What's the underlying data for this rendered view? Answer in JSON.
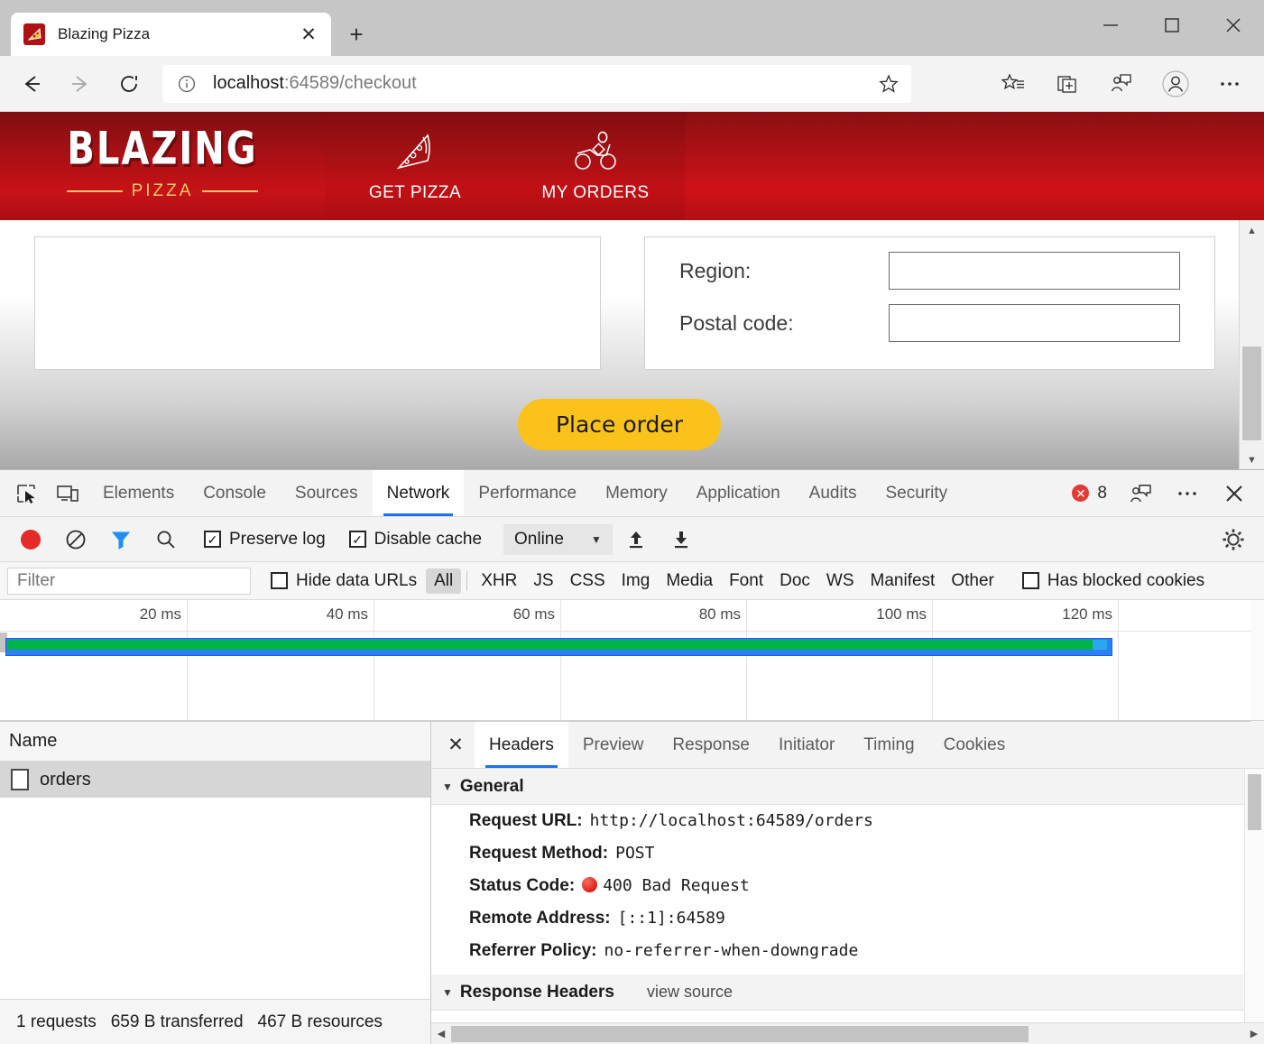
{
  "browser": {
    "tab": {
      "title": "Blazing Pizza",
      "favicon": "pizza-icon",
      "close": "✕"
    },
    "new_tab": "+",
    "window_controls": {
      "minimize": "minimize-icon",
      "maximize": "maximize-icon",
      "close": "close-icon"
    },
    "nav": {
      "back": "back-arrow-icon",
      "forward": "forward-arrow-icon",
      "reload": "reload-icon",
      "info": "info-icon",
      "url_host": "localhost",
      "url_rest": ":64589/checkout",
      "url_full": "localhost:64589/checkout",
      "star": "favorite-star-icon"
    },
    "toolbar_icons": [
      "favorites-list-icon",
      "collections-icon",
      "feedback-icon",
      "profile-icon",
      "more-settings-icon"
    ]
  },
  "site": {
    "brand_top": "BLAZING",
    "brand_bottom": "PIZZA",
    "nav": [
      {
        "label": "GET PIZZA",
        "icon": "pizza-slice-icon"
      },
      {
        "label": "MY ORDERS",
        "icon": "delivery-scooter-icon"
      }
    ],
    "form": {
      "fields": [
        {
          "label": "Region:",
          "value": ""
        },
        {
          "label": "Postal code:",
          "value": ""
        }
      ]
    },
    "place_order": "Place order",
    "colors": {
      "brand_red": "#c81217",
      "accent_yellow": "#fbc21c",
      "brand_gold": "#f3c96b"
    }
  },
  "devtools": {
    "tabs": [
      {
        "label": "Elements",
        "active": false
      },
      {
        "label": "Console",
        "active": false
      },
      {
        "label": "Sources",
        "active": false
      },
      {
        "label": "Network",
        "active": true
      },
      {
        "label": "Performance",
        "active": false
      },
      {
        "label": "Memory",
        "active": false
      },
      {
        "label": "Application",
        "active": false
      },
      {
        "label": "Audits",
        "active": false
      },
      {
        "label": "Security",
        "active": false
      }
    ],
    "left_icons": [
      "inspect-element-icon",
      "device-toolbar-icon"
    ],
    "errors": {
      "count": "8",
      "mark": "✕"
    },
    "right_icons": [
      "feedback-icon",
      "more-options-icon",
      "close-devtools-icon"
    ],
    "toolbar": {
      "record": "record-button",
      "clear": "clear-icon",
      "filter": "filter-funnel-icon",
      "search": "search-icon",
      "preserve_log": {
        "label": "Preserve log",
        "checked": true,
        "mark": "✓"
      },
      "disable_cache": {
        "label": "Disable cache",
        "checked": true,
        "mark": "✓"
      },
      "throttle": {
        "value": "Online",
        "caret": "▼"
      },
      "import": "import-har-icon",
      "export": "export-har-icon",
      "settings": "gear-icon"
    },
    "filterbar": {
      "placeholder": "Filter",
      "value": "",
      "hide_data_urls": {
        "label": "Hide data URLs",
        "checked": false
      },
      "types": [
        {
          "label": "All",
          "active": true
        },
        {
          "label": "XHR",
          "active": false
        },
        {
          "label": "JS",
          "active": false
        },
        {
          "label": "CSS",
          "active": false
        },
        {
          "label": "Img",
          "active": false
        },
        {
          "label": "Media",
          "active": false
        },
        {
          "label": "Font",
          "active": false
        },
        {
          "label": "Doc",
          "active": false
        },
        {
          "label": "WS",
          "active": false
        },
        {
          "label": "Manifest",
          "active": false
        },
        {
          "label": "Other",
          "active": false
        }
      ],
      "has_blocked_cookies": {
        "label": "Has blocked cookies",
        "checked": false
      }
    },
    "overview": {
      "ticks": [
        "20 ms",
        "40 ms",
        "60 ms",
        "80 ms",
        "100 ms",
        "120 ms"
      ],
      "bar_colors": {
        "green": "#00b44c",
        "blue": "#2d7ff9",
        "cyan": "#29a8f0"
      }
    },
    "requests": {
      "column_header": "Name",
      "rows": [
        {
          "name": "orders",
          "icon": "document-icon",
          "selected": true
        }
      ],
      "status": {
        "requests": "1 requests",
        "transferred": "659 B transferred",
        "resources": "467 B resources"
      }
    },
    "detail": {
      "close": "✕",
      "tabs": [
        {
          "label": "Headers",
          "active": true
        },
        {
          "label": "Preview",
          "active": false
        },
        {
          "label": "Response",
          "active": false
        },
        {
          "label": "Initiator",
          "active": false
        },
        {
          "label": "Timing",
          "active": false
        },
        {
          "label": "Cookies",
          "active": false
        }
      ],
      "general": {
        "title": "General",
        "triangle": "▼",
        "rows": [
          {
            "key": "Request URL:",
            "value": "http://localhost:64589/orders",
            "dot": false
          },
          {
            "key": "Request Method:",
            "value": "POST",
            "dot": false
          },
          {
            "key": "Status Code:",
            "value": "400 Bad Request",
            "dot": true
          },
          {
            "key": "Remote Address:",
            "value": "[::1]:64589",
            "dot": false
          },
          {
            "key": "Referrer Policy:",
            "value": "no-referrer-when-downgrade",
            "dot": false
          }
        ]
      },
      "response_headers": {
        "title": "Response Headers",
        "triangle": "▼",
        "view_source": "view source"
      }
    }
  }
}
